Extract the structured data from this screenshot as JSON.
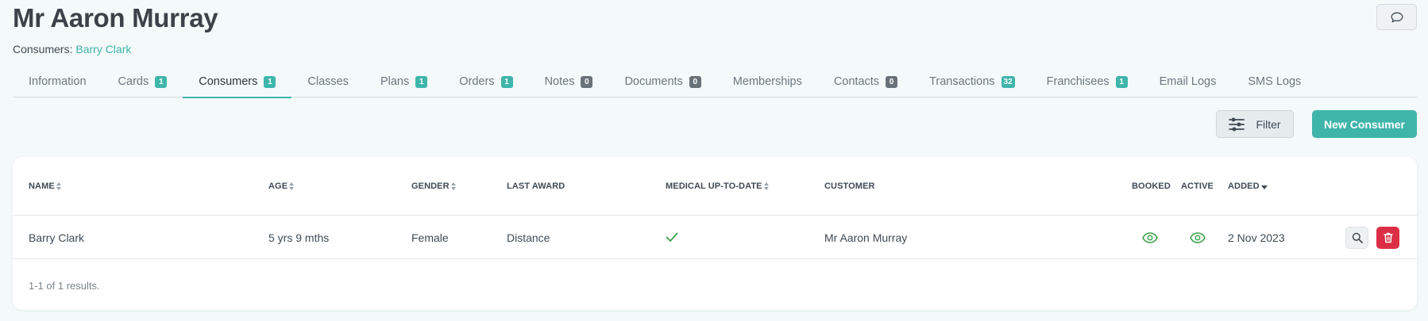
{
  "header": {
    "title": "Mr Aaron Murray",
    "breadcrumb_label": "Consumers:",
    "breadcrumb_link": "Barry Clark"
  },
  "tabs": [
    {
      "label": "Information",
      "badge": ""
    },
    {
      "label": "Cards",
      "badge": "1"
    },
    {
      "label": "Consumers",
      "badge": "1"
    },
    {
      "label": "Classes",
      "badge": ""
    },
    {
      "label": "Plans",
      "badge": "1"
    },
    {
      "label": "Orders",
      "badge": "1"
    },
    {
      "label": "Notes",
      "badge": "0"
    },
    {
      "label": "Documents",
      "badge": "0"
    },
    {
      "label": "Memberships",
      "badge": ""
    },
    {
      "label": "Contacts",
      "badge": "0"
    },
    {
      "label": "Transactions",
      "badge": "32"
    },
    {
      "label": "Franchisees",
      "badge": "1"
    },
    {
      "label": "Email Logs",
      "badge": ""
    },
    {
      "label": "SMS Logs",
      "badge": ""
    }
  ],
  "active_tab": "Consumers",
  "toolbar": {
    "filter_label": "Filter",
    "new_label": "New Consumer"
  },
  "table": {
    "columns": {
      "name": "Name",
      "age": "Age",
      "gender": "Gender",
      "last_award": "Last Award",
      "medical": "Medical Up-To-Date",
      "customer": "Customer",
      "booked": "Booked",
      "active": "Active",
      "added": "Added"
    },
    "rows": [
      {
        "name": "Barry Clark",
        "age": "5 yrs 9 mths",
        "gender": "Female",
        "last_award": "Distance",
        "medical": "check-icon",
        "customer": "Mr Aaron Murray",
        "booked": "eye-icon",
        "active": "eye-icon",
        "added": "2 Nov 2023"
      }
    ],
    "footer": "1-1 of 1 results."
  },
  "colors": {
    "accent": "#3fb5aa",
    "danger": "#dc2f45",
    "success": "#3fa24a",
    "badge_dark": "#6a7279"
  }
}
